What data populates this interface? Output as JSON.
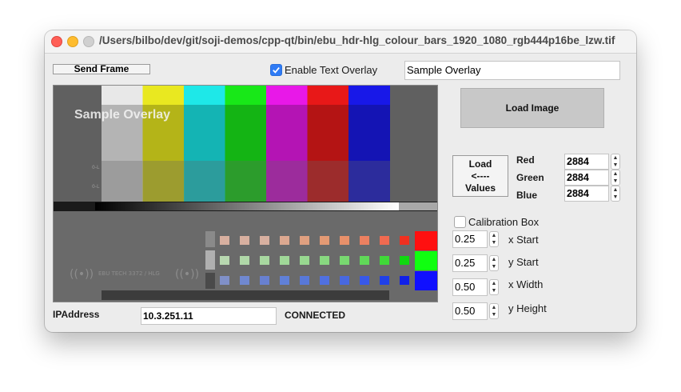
{
  "window": {
    "title": "/Users/bilbo/dev/git/soji-demos/cpp-qt/bin/ebu_hdr-hlg_colour_bars_1920_1080_rgb444p16be_lzw.tif"
  },
  "toolbar": {
    "send_frame_label": "Send Frame",
    "enable_overlay_label": "Enable Text Overlay",
    "enable_overlay_checked": true,
    "overlay_text_value": "Sample Overlay"
  },
  "preview": {
    "overlay_text": "Sample Overlay",
    "bar_colors": [
      "#e8e8e8",
      "#e9e820",
      "#1ee8e8",
      "#18e818",
      "#e818e8",
      "#e81818",
      "#1818e8"
    ],
    "lower_bar_colors": [
      "#b4b4b4",
      "#b4b418",
      "#14b4b4",
      "#14b414",
      "#b414b4",
      "#b41414",
      "#1414b4"
    ],
    "small_labels": [
      "0-L",
      "0-L"
    ],
    "logo_text": "EBU TECH 3372 / HLG"
  },
  "right_panel": {
    "load_image_label": "Load Image",
    "load_values_label": "Load\n<----\nValues",
    "red_label": "Red",
    "green_label": "Green",
    "blue_label": "Blue",
    "red_value": "2884",
    "green_value": "2884",
    "blue_value": "2884",
    "calibration_box_label": "Calibration Box",
    "calibration_box_checked": false,
    "x_start_value": "0.25",
    "y_start_value": "0.25",
    "x_width_value": "0.50",
    "y_height_value": "0.50",
    "x_start_label": "x Start",
    "y_start_label": "y Start",
    "x_width_label": "x Width",
    "y_height_label": "y Height"
  },
  "footer": {
    "ip_label": "IPAddress",
    "ip_value": "10.3.251.11",
    "status": "CONNECTED"
  }
}
